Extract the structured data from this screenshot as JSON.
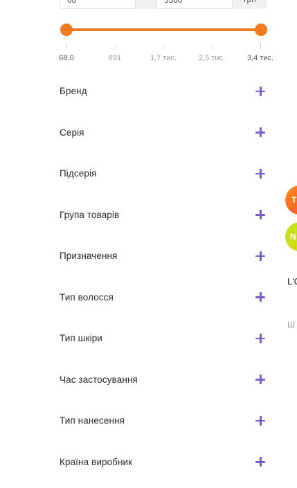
{
  "price": {
    "from_value": "68",
    "to_value": "3380",
    "currency": "грн"
  },
  "slider": {
    "min_fraction": 0.0,
    "max_fraction": 1.0,
    "tick_labels": [
      "68,0",
      "891",
      "1,7 тис.",
      "2,5 тис.",
      "3,4 тис."
    ]
  },
  "filters": [
    {
      "label": "Бренд",
      "icon": "plus-icon"
    },
    {
      "label": "Серія",
      "icon": "plus-icon"
    },
    {
      "label": "Підсерія",
      "icon": "plus-icon"
    },
    {
      "label": "Група товарів",
      "icon": "plus-icon"
    },
    {
      "label": "Призначення",
      "icon": "plus-icon"
    },
    {
      "label": "Тип волосся",
      "icon": "plus-icon"
    },
    {
      "label": "Тип шкіри",
      "icon": "plus-icon"
    },
    {
      "label": "Час застосування",
      "icon": "plus-icon"
    },
    {
      "label": "Тип нанесення",
      "icon": "plus-icon"
    },
    {
      "label": "Країна виробник",
      "icon": "plus-icon"
    }
  ],
  "edge": {
    "badge_top": "T",
    "badge_new": "N",
    "brand": "L'O",
    "text": "Ш"
  },
  "colors": {
    "accent": "#f47a1f",
    "plus": "#7a5cc8"
  }
}
